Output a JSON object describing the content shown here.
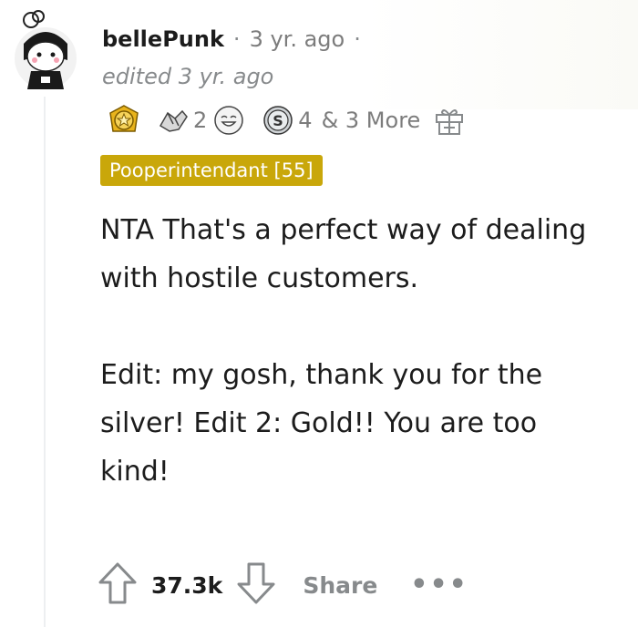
{
  "comment": {
    "username": "bellePunk",
    "separator": "·",
    "time_ago": "3 yr. ago",
    "trailing_separator": "·",
    "edited": "edited 3 yr. ago",
    "awards": {
      "items": [
        {
          "icon": "gold-award-icon",
          "count": ""
        },
        {
          "icon": "handshake-award-icon",
          "count": "2"
        },
        {
          "icon": "laughing-face-award-icon",
          "count": ""
        },
        {
          "icon": "silver-award-icon",
          "count": "4"
        }
      ],
      "more_text": "& 3 More",
      "give_award_icon": "gift-icon"
    },
    "flair": "Pooperintendant [55]",
    "body": [
      "NTA That's a perfect way of dealing with hostile customers.",
      "Edit: my gosh, thank you for the silver! Edit 2: Gold!! You are too kind!"
    ],
    "actions": {
      "vote_count": "37.3k",
      "share_label": "Share",
      "more_label": "•••"
    }
  },
  "colors": {
    "flair_bg": "#c9a70a",
    "meta_gray": "#878a8c",
    "text": "#1c1c1c"
  }
}
